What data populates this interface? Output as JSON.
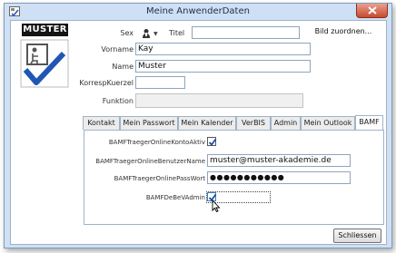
{
  "window": {
    "title": "Meine AnwenderDaten"
  },
  "logo": {
    "text": "MUSTER"
  },
  "person": {
    "sex_label": "Sex",
    "titel_label": "Titel",
    "titel_value": "",
    "vorname_label": "Vorname",
    "vorname_value": "Kay",
    "name_label": "Name",
    "name_value": "Muster",
    "kuerzel_label": "KorrespKuerzel",
    "kuerzel_value": "",
    "funktion_label": "Funktion",
    "funktion_value": "",
    "bild_button": "Bild zuordnen..."
  },
  "tabs": [
    {
      "label": "Kontakt"
    },
    {
      "label": "Mein Passwort"
    },
    {
      "label": "Mein Kalender"
    },
    {
      "label": "VerBIS"
    },
    {
      "label": "Admin"
    },
    {
      "label": "Mein Outlook"
    },
    {
      "label": "BAMF"
    }
  ],
  "active_tab": "BAMF",
  "bamf": {
    "online_aktiv_label": "BAMFTraegerOnlineKontoAktiv",
    "online_aktiv_checked": true,
    "benutzername_label": "BAMFTraegerOnlineBenutzerName",
    "benutzername_value": "muster@muster-akademie.de",
    "passwort_label": "BAMFTraegerOnlinePassWort",
    "passwort_value": "●●●●●●●●●●●",
    "debev_admin_label": "BAMFDeBeVAdmin",
    "debev_admin_checked": true
  },
  "footer": {
    "close_label": "Schliessen"
  },
  "colors": {
    "titlebar": "#cfe0f5",
    "close_red": "#c94a2f",
    "check_blue": "#1b4fa0",
    "logo_check": "#1f57b3"
  },
  "icons": [
    "app-icon",
    "close-icon",
    "person-icon",
    "dropdown-arrow-icon",
    "checkmark-icon",
    "mouse-cursor-icon"
  ]
}
